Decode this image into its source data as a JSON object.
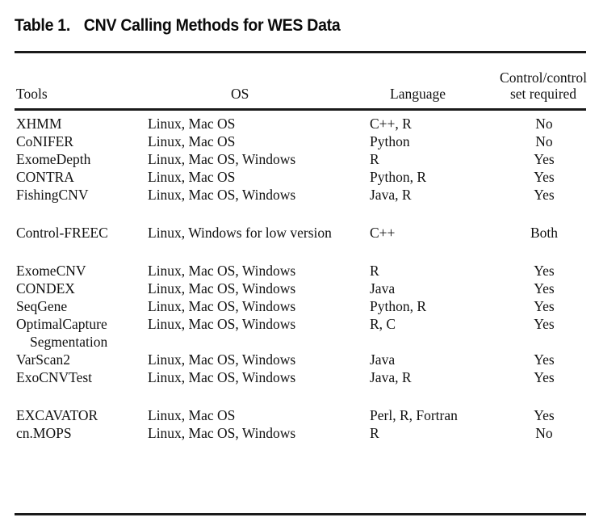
{
  "title": {
    "number": "Table 1.",
    "text": "CNV Calling Methods for WES Data"
  },
  "columns": {
    "tools": "Tools",
    "os": "OS",
    "language": "Language",
    "control_line1": "Control/control",
    "control_line2": "set required"
  },
  "rows": [
    {
      "tool": "XHMM",
      "os": "Linux, Mac OS",
      "language": "C++, R",
      "required": "No",
      "gap": false,
      "indent": false,
      "cont": ""
    },
    {
      "tool": "CoNIFER",
      "os": "Linux, Mac OS",
      "language": "Python",
      "required": "No",
      "gap": false,
      "indent": false,
      "cont": ""
    },
    {
      "tool": "ExomeDepth",
      "os": "Linux, Mac OS, Windows",
      "language": "R",
      "required": "Yes",
      "gap": false,
      "indent": false,
      "cont": ""
    },
    {
      "tool": "CONTRA",
      "os": "Linux, Mac OS",
      "language": "Python, R",
      "required": "Yes",
      "gap": false,
      "indent": false,
      "cont": ""
    },
    {
      "tool": "FishingCNV",
      "os": "Linux, Mac OS, Windows",
      "language": "Java, R",
      "required": "Yes",
      "gap": false,
      "indent": false,
      "cont": ""
    },
    {
      "tool": "Control-FREEC",
      "os": "Linux, Windows for low version",
      "language": "C++",
      "required": "Both",
      "gap": true,
      "indent": false,
      "cont": ""
    },
    {
      "tool": "ExomeCNV",
      "os": "Linux, Mac OS, Windows",
      "language": "R",
      "required": "Yes",
      "gap": true,
      "indent": false,
      "cont": ""
    },
    {
      "tool": "CONDEX",
      "os": "Linux, Mac OS, Windows",
      "language": "Java",
      "required": "Yes",
      "gap": false,
      "indent": false,
      "cont": ""
    },
    {
      "tool": "SeqGene",
      "os": "Linux, Mac OS, Windows",
      "language": "Python, R",
      "required": "Yes",
      "gap": false,
      "indent": false,
      "cont": ""
    },
    {
      "tool": "OptimalCapture",
      "os": "Linux, Mac OS, Windows",
      "language": "R, C",
      "required": "Yes",
      "gap": false,
      "indent": false,
      "cont": "Segmentation"
    },
    {
      "tool": "VarScan2",
      "os": "Linux, Mac OS, Windows",
      "language": "Java",
      "required": "Yes",
      "gap": false,
      "indent": false,
      "cont": ""
    },
    {
      "tool": "ExoCNVTest",
      "os": "Linux, Mac OS, Windows",
      "language": "Java, R",
      "required": "Yes",
      "gap": false,
      "indent": false,
      "cont": ""
    },
    {
      "tool": "EXCAVATOR",
      "os": "Linux, Mac OS",
      "language": "Perl, R, Fortran",
      "required": "Yes",
      "gap": true,
      "indent": false,
      "cont": ""
    },
    {
      "tool": "cn.MOPS",
      "os": "Linux, Mac OS, Windows",
      "language": "R",
      "required": "No",
      "gap": false,
      "indent": false,
      "cont": ""
    }
  ]
}
